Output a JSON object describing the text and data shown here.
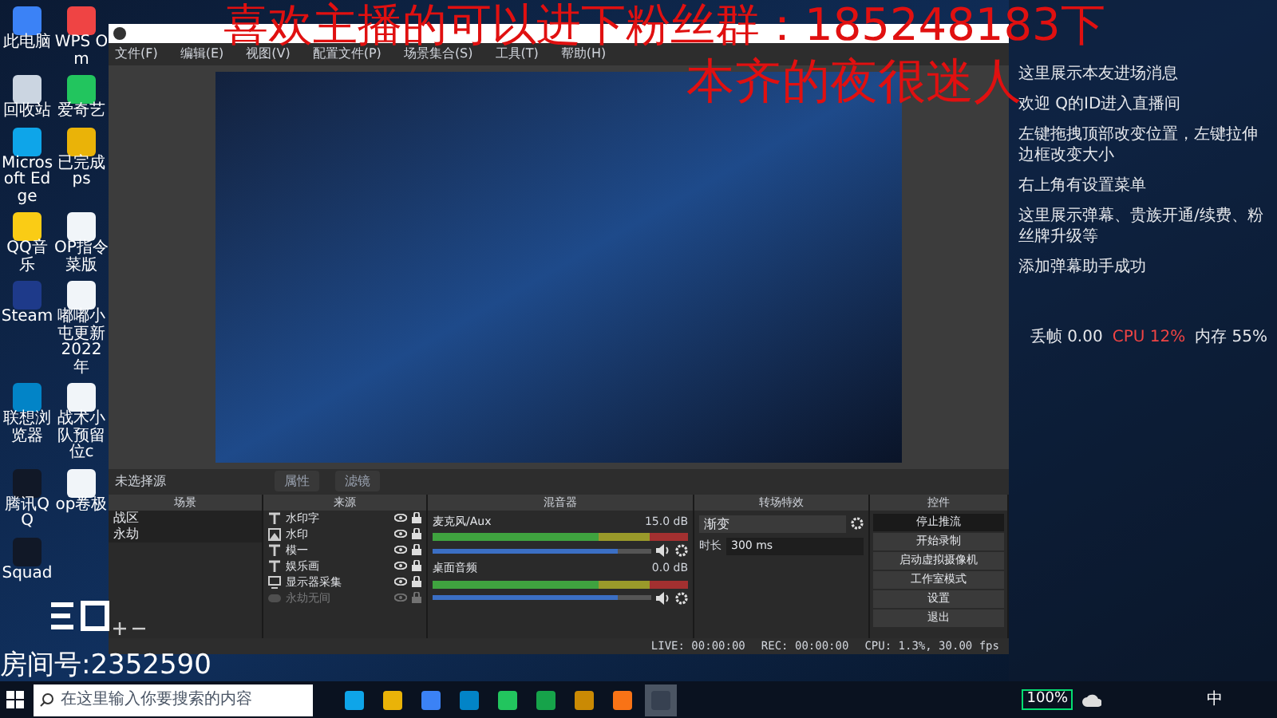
{
  "overlay": {
    "banner": "喜欢主播的可以进下粉丝群：185248183下",
    "tagline": "本齐的夜很迷人",
    "room": "房间号:2352590"
  },
  "desktop": {
    "icons": [
      {
        "label": "此电脑",
        "color": "#3b82f6"
      },
      {
        "label": "WPS Om",
        "color": "#ef4444"
      },
      {
        "label": "回收站",
        "color": "#cbd5e1"
      },
      {
        "label": "爱奇艺",
        "color": "#22c55e"
      },
      {
        "label": "Microsoft Edge",
        "color": "#0ea5e9"
      },
      {
        "label": "已完成ps",
        "color": "#eab308"
      },
      {
        "label": "QQ音乐",
        "color": "#facc15"
      },
      {
        "label": "OP指令菜版",
        "color": "#f1f5f9"
      },
      {
        "label": "Steam",
        "color": "#1e3a8a"
      },
      {
        "label": "嘟嘟小屯更新2022年",
        "color": "#f1f5f9"
      },
      {
        "label": "联想浏览器",
        "color": "#0284c7"
      },
      {
        "label": "战术小队预留位c",
        "color": "#f1f5f9"
      },
      {
        "label": "腾讯QQ",
        "color": "#111827"
      },
      {
        "label": "op卷极",
        "color": "#f1f5f9"
      },
      {
        "label": "Squad",
        "color": "#111827"
      }
    ]
  },
  "obs": {
    "menu": [
      "文件(F)",
      "编辑(E)",
      "视图(V)",
      "配置文件(P)",
      "场景集合(S)",
      "工具(T)",
      "帮助(H)"
    ],
    "toolbar": {
      "status": "未选择源",
      "buttons": [
        "属性",
        "滤镜"
      ]
    },
    "scenes": {
      "title": "场景",
      "items": [
        "战区",
        "永劫"
      ]
    },
    "sources": {
      "title": "来源",
      "items": [
        {
          "name": "水印字",
          "kind": "text",
          "disabled": false
        },
        {
          "name": "水印",
          "kind": "image",
          "disabled": false
        },
        {
          "name": "模一",
          "kind": "text",
          "disabled": false
        },
        {
          "name": "娱乐画",
          "kind": "text",
          "disabled": false
        },
        {
          "name": "显示器采集",
          "kind": "display",
          "disabled": false
        },
        {
          "name": "永劫无间",
          "kind": "game",
          "disabled": true
        }
      ]
    },
    "mixer": {
      "title": "混音器",
      "channels": [
        {
          "name": "麦克风/Aux",
          "reading": "15.0 dB",
          "level": 0.85
        },
        {
          "name": "桌面音频",
          "reading": "0.0 dB",
          "level": 0.85
        }
      ]
    },
    "transitions": {
      "title": "转场特效",
      "type": "渐变",
      "duration_label": "时长",
      "duration": "300 ms"
    },
    "controls": {
      "title": "控件",
      "buttons": [
        {
          "label": "停止推流",
          "active": true
        },
        {
          "label": "开始录制",
          "active": false
        },
        {
          "label": "启动虚拟摄像机",
          "active": false
        },
        {
          "label": "工作室模式",
          "active": false
        },
        {
          "label": "设置",
          "active": false
        },
        {
          "label": "退出",
          "active": false
        }
      ]
    },
    "status": {
      "live": "LIVE: 00:00:00",
      "rec": "REC: 00:00:00",
      "cpu": "CPU: 1.3%, 30.00 fps"
    }
  },
  "chat": {
    "lines": [
      "这里展示本友进场消息",
      "欢迎 Q的ID进入直播间",
      "左键拖拽顶部改变位置，左键拉伸边框改变大小",
      "右上角有设置菜单",
      "这里展示弹幕、贵族开通/续费、粉丝牌升级等",
      "添加弹幕助手成功"
    ],
    "stats": [
      {
        "text": "丢帧 0.00",
        "color": "#e5e7eb"
      },
      {
        "text": "CPU 12%",
        "color": "#ef4444"
      },
      {
        "text": "内存 55%",
        "color": "#e5e7eb"
      }
    ]
  },
  "taskbar": {
    "search": {
      "placeholder": "在这里输入你要搜索的内容"
    },
    "apps": [
      {
        "color": "#0ea5e9",
        "selected": false
      },
      {
        "color": "#eab308",
        "selected": false
      },
      {
        "color": "#3b82f6",
        "selected": false
      },
      {
        "color": "#0284c7",
        "selected": false
      },
      {
        "color": "#22c55e",
        "selected": false
      },
      {
        "color": "#16a34a",
        "selected": false
      },
      {
        "color": "#ca8a04",
        "selected": false
      },
      {
        "color": "#f97316",
        "selected": false
      },
      {
        "color": "#374151",
        "selected": true
      }
    ],
    "battery": "100%",
    "ime": "中"
  }
}
